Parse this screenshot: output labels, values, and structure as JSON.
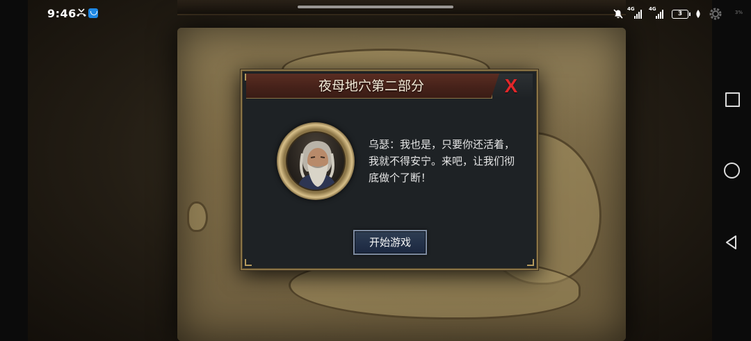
{
  "status_bar": {
    "time": "9:46",
    "network_1": "4G",
    "network_2": "4G",
    "battery_level": "3",
    "status_percent": "3%"
  },
  "dialog": {
    "title": "夜母地穴第二部分",
    "close_label": "X",
    "message": "乌瑟：我也是，只要你还活着，我就不得安宁。来吧，让我们彻底做个了断！",
    "start_button_label": "开始游戏"
  },
  "icons": {
    "close": "close-icon",
    "portrait": "character-portrait",
    "settings": "gear-icon",
    "mute": "bell-muted-icon",
    "battery": "battery-icon",
    "nav_recents": "recents-square-icon",
    "nav_home": "home-circle-icon",
    "nav_back": "back-triangle-icon"
  },
  "colors": {
    "dialog_background": "#1e2225",
    "dialog_border": "#8a7446",
    "header_background": "#46221a",
    "close_x": "#e2272a",
    "button_background": "#24324a",
    "text": "#e6e6e6"
  }
}
